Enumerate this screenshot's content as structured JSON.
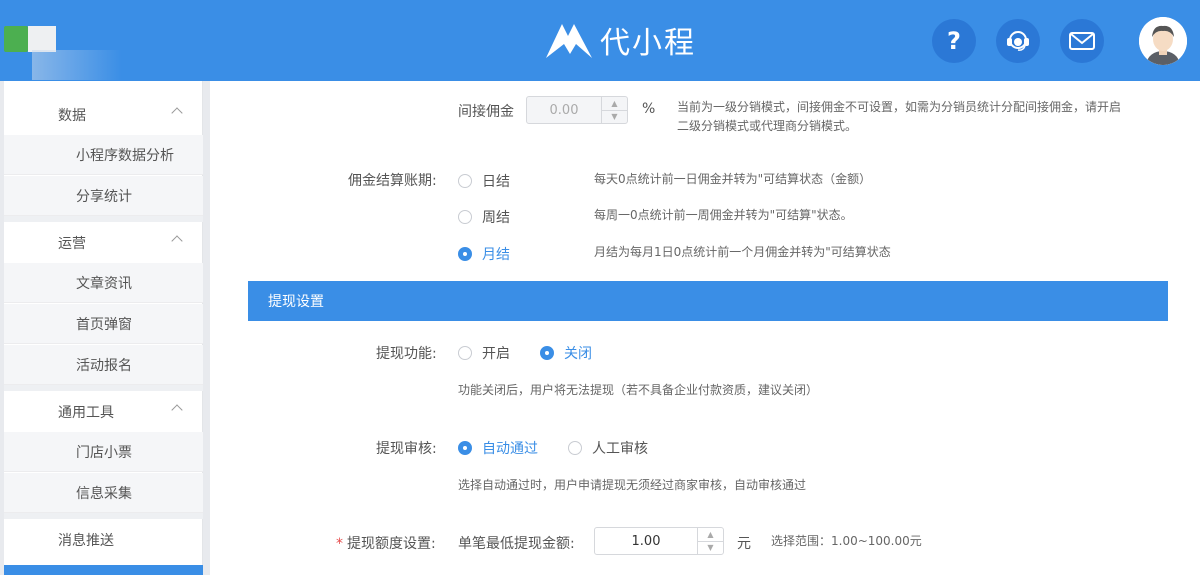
{
  "header": {
    "brand_name": "代小程",
    "brand_color": "#3a8ee6",
    "icons": [
      "help-icon",
      "customer-service-icon",
      "mail-icon"
    ],
    "help_glyph": "?"
  },
  "sidebar": {
    "groups": [
      {
        "label": "数据",
        "items": [
          "小程序数据分析",
          "分享统计"
        ]
      },
      {
        "label": "运营",
        "items": [
          "文章资讯",
          "首页弹窗",
          "活动报名"
        ]
      },
      {
        "label": "通用工具",
        "items": [
          "门店小票",
          "信息采集"
        ]
      },
      {
        "label": "消息推送",
        "items": []
      }
    ]
  },
  "main": {
    "indirect_commission": {
      "label": "间接佣金",
      "value": "0.00",
      "unit": "%",
      "hint": "当前为一级分销模式，间接佣金不可设置，如需为分销员统计分配间接佣金，请开启二级分销模式或代理商分销模式。"
    },
    "settlement": {
      "label": "佣金结算账期:",
      "options": [
        {
          "label": "日结",
          "desc": "每天0点统计前一日佣金并转为\"可结算状态（金额）",
          "selected": false
        },
        {
          "label": "周结",
          "desc": "每周一0点统计前一周佣金并转为\"可结算\"状态。",
          "selected": false
        },
        {
          "label": "月结",
          "desc": "月结为每月1日0点统计前一个月佣金并转为\"可结算状态",
          "selected": true
        }
      ]
    },
    "withdraw_section": {
      "title": "提现设置",
      "function": {
        "label": "提现功能:",
        "options": [
          "开启",
          "关闭"
        ],
        "selected": "关闭",
        "hint": "功能关闭后，用户将无法提现（若不具备企业付款资质，建议关闭）"
      },
      "review": {
        "label": "提现审核:",
        "options": [
          "自动通过",
          "人工审核"
        ],
        "selected": "自动通过",
        "hint": "选择自动通过时，用户申请提现无须经过商家审核，自动审核通过"
      },
      "limit": {
        "required_mark": "*",
        "label": "提现额度设置:",
        "sub_label": "单笔最低提现金额:",
        "value": "1.00",
        "unit": "元",
        "range": "选择范围：1.00~100.00元"
      }
    }
  }
}
